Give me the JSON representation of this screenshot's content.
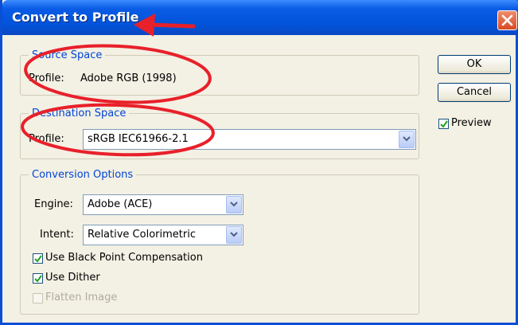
{
  "dialog": {
    "title": "Convert to Profile",
    "close_icon": "close-icon"
  },
  "source_space": {
    "legend": "Source Space",
    "profile_label": "Profile:",
    "profile_value": "Adobe RGB (1998)"
  },
  "destination_space": {
    "legend": "Destination Space",
    "profile_label": "Profile:",
    "profile_value": "sRGB IEC61966-2.1"
  },
  "conversion_options": {
    "legend": "Conversion Options",
    "engine_label": "Engine:",
    "engine_value": "Adobe (ACE)",
    "intent_label": "Intent:",
    "intent_value": "Relative Colorimetric",
    "black_point_label": "Use Black Point Compensation",
    "black_point_checked": true,
    "dither_label": "Use Dither",
    "dither_checked": true,
    "flatten_label": "Flatten Image",
    "flatten_checked": false,
    "flatten_enabled": false
  },
  "buttons": {
    "ok": "OK",
    "cancel": "Cancel"
  },
  "preview": {
    "label": "Preview",
    "checked": true
  },
  "colors": {
    "title_bar": "#0253d9",
    "legend_text": "#0046d5",
    "annotation": "#e8202a",
    "dialog_bg": "#f3f0e4"
  }
}
